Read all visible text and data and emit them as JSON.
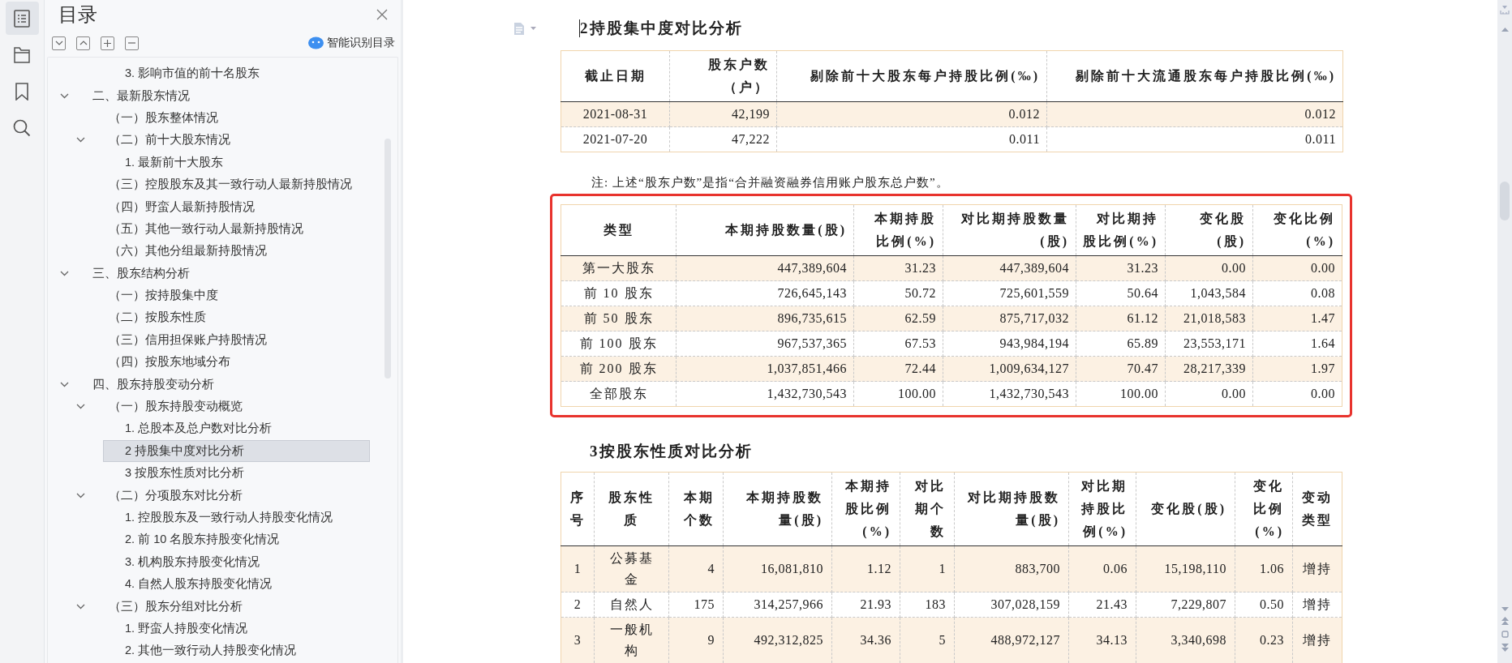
{
  "rail": [
    {
      "kind": "contents",
      "selected": true
    },
    {
      "kind": "outline",
      "selected": false
    },
    {
      "kind": "bookmark",
      "selected": false
    },
    {
      "kind": "search",
      "selected": false
    }
  ],
  "sidebar": {
    "title": "目录",
    "smart_button": "智能识别目录"
  },
  "toc": {
    "items": [
      {
        "children": [
          {
            "children": [
              {
                "label": "3. 影响市值的前十名股东",
                "selected": false
              }
            ]
          }
        ]
      },
      {
        "label": "二、最新股东情况",
        "expanded": true,
        "selected": false,
        "children": [
          {
            "label": "（一）股东整体情况",
            "selected": false
          },
          {
            "label": "（二）前十大股东情况",
            "expanded": true,
            "selected": false,
            "children": [
              {
                "label": "1. 最新前十大股东",
                "selected": false
              }
            ]
          },
          {
            "label": "（三）控股股东及其一致行动人最新持股情况",
            "selected": false
          },
          {
            "label": "（四）野蛮人最新持股情况",
            "selected": false
          },
          {
            "label": "（五）其他一致行动人最新持股情况",
            "selected": false
          },
          {
            "label": "（六）其他分组最新持股情况",
            "selected": false
          }
        ]
      },
      {
        "label": "三、股东结构分析",
        "expanded": true,
        "selected": false,
        "children": [
          {
            "label": "（一）按持股集中度",
            "selected": false
          },
          {
            "label": "（二）按股东性质",
            "selected": false
          },
          {
            "label": "（三）信用担保账户持股情况",
            "selected": false
          },
          {
            "label": "（四）按股东地域分布",
            "selected": false
          }
        ]
      },
      {
        "label": "四、股东持股变动分析",
        "expanded": true,
        "selected": false,
        "children": [
          {
            "label": "（一）股东持股变动概览",
            "expanded": true,
            "selected": false,
            "children": [
              {
                "label": "1. 总股本及总户数对比分析",
                "selected": false
              },
              {
                "label": "2 持股集中度对比分析",
                "selected": true
              },
              {
                "label": "3 按股东性质对比分析",
                "selected": false
              }
            ]
          },
          {
            "label": "（二）分项股东对比分析",
            "expanded": true,
            "selected": false,
            "children": [
              {
                "label": "1. 控股股东及一致行动人持股变化情况",
                "selected": false
              },
              {
                "label": "2. 前 10 名股东持股变化情况",
                "selected": false
              },
              {
                "label": "3. 机构股东持股变化情况",
                "selected": false
              },
              {
                "label": "4. 自然人股东持股变化情况",
                "selected": false
              }
            ]
          },
          {
            "label": "（三）股东分组对比分析",
            "expanded": true,
            "selected": false,
            "children": [
              {
                "label": "1. 野蛮人持股变化情况",
                "selected": false
              },
              {
                "label": "2. 其他一致行动人持股变化情况",
                "selected": false
              }
            ]
          }
        ]
      }
    ]
  },
  "document": {
    "sections": [
      {
        "heading": "2持股集中度对比分析",
        "caret": true,
        "highlighted": false,
        "table": {
          "columns": [
            "截止日期",
            "股东户数（户）",
            "剔除前十大股东每户持股比例(‰)",
            "剔除前十大流通股东每户持股比例(‰)"
          ],
          "rows": [
            [
              "2021-08-31",
              "42,199",
              "0.012",
              "0.012"
            ],
            [
              "2021-07-20",
              "47,222",
              "0.011",
              "0.011"
            ]
          ]
        },
        "note": "注: 上述“股东户数”是指“合并融资融券信用账户股东总户数”。"
      },
      {
        "caret": false,
        "highlighted": true,
        "table": {
          "columns": [
            "类型",
            "本期持股数量(股)",
            "本期持股比例(%)",
            "对比期持股数量(股)",
            "对比期持股比例(%)",
            "变化股(股)",
            "变化比例(%)"
          ],
          "rows": [
            [
              "第一大股东",
              "447,389,604",
              "31.23",
              "447,389,604",
              "31.23",
              "0.00",
              "0.00"
            ],
            [
              "前 10 股东",
              "726,645,143",
              "50.72",
              "725,601,559",
              "50.64",
              "1,043,584",
              "0.08"
            ],
            [
              "前 50 股东",
              "896,735,615",
              "62.59",
              "875,717,032",
              "61.12",
              "21,018,583",
              "1.47"
            ],
            [
              "前 100 股东",
              "967,537,365",
              "67.53",
              "943,984,194",
              "65.89",
              "23,553,171",
              "1.64"
            ],
            [
              "前 200 股东",
              "1,037,851,466",
              "72.44",
              "1,009,634,127",
              "70.47",
              "28,217,339",
              "1.97"
            ],
            [
              "全部股东",
              "1,432,730,543",
              "100.00",
              "1,432,730,543",
              "100.00",
              "0.00",
              "0.00"
            ]
          ]
        }
      },
      {
        "heading": "3按股东性质对比分析",
        "caret": false,
        "highlighted": false,
        "table": {
          "columns": [
            "序号",
            "股东性质",
            "本期个数",
            "本期持股数量(股)",
            "本期持股比例(%)",
            "对比期个数",
            "对比期持股数量(股)",
            "对比期持股比例(%)",
            "变化股(股)",
            "变化比例(%)",
            "变动类型"
          ],
          "rows": [
            [
              "1",
              "公募基金",
              "4",
              "16,081,810",
              "1.12",
              "1",
              "883,700",
              "0.06",
              "15,198,110",
              "1.06",
              "增持"
            ],
            [
              "2",
              "自然人",
              "175",
              "314,257,966",
              "21.93",
              "183",
              "307,028,159",
              "21.43",
              "7,229,807",
              "0.50",
              "增持"
            ],
            [
              "3",
              "一般机构",
              "9",
              "492,312,825",
              "34.36",
              "5",
              "488,972,127",
              "34.13",
              "3,340,698",
              "0.23",
              "增持"
            ]
          ]
        }
      }
    ]
  }
}
